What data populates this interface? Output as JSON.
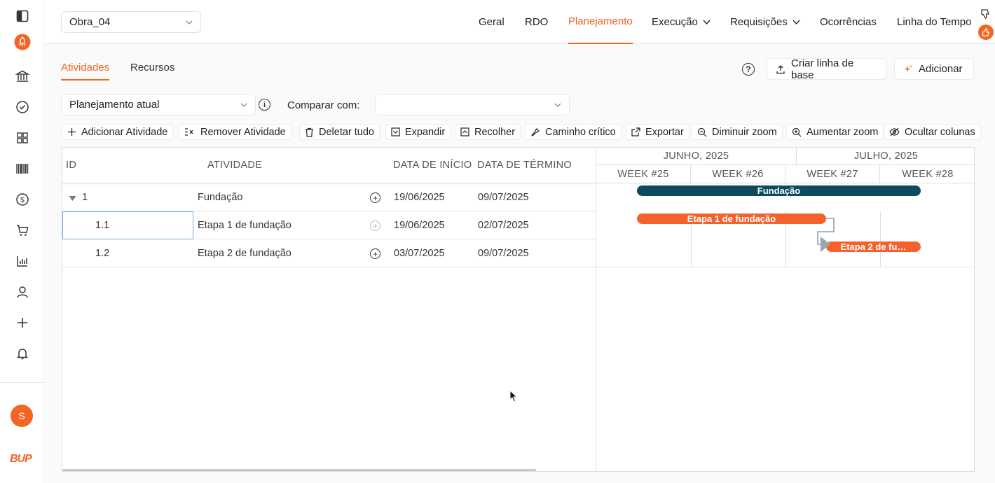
{
  "project_select": {
    "value": "Obra_04"
  },
  "nav": [
    {
      "label": "Geral"
    },
    {
      "label": "RDO"
    },
    {
      "label": "Planejamento"
    },
    {
      "label": "Execução"
    },
    {
      "label": "Requisições"
    },
    {
      "label": "Ocorrências"
    },
    {
      "label": "Linha do Tempo"
    }
  ],
  "subtabs": {
    "activities": "Atividades",
    "resources": "Recursos"
  },
  "actions": {
    "baseline": "Criar linha de base",
    "add": "Adicionar"
  },
  "plan_select": {
    "value": "Planejamento atual"
  },
  "compare": {
    "label": "Comparar com:",
    "value": ""
  },
  "toolbar": {
    "add_activity": "Adicionar Atividade",
    "remove_activity": "Remover Atividade",
    "delete_all": "Deletar tudo",
    "expand": "Expandir",
    "collapse": "Recolher",
    "critical_path": "Caminho crítico",
    "export": "Exportar",
    "zoom_out": "Diminuir zoom",
    "zoom_in": "Aumentar zoom",
    "hide_columns": "Ocultar colunas"
  },
  "grid": {
    "headers": {
      "id": "ID",
      "activity": "ATIVIDADE",
      "start": "DATA DE INÍCIO",
      "end": "DATA DE TÉRMINO"
    },
    "rows": [
      {
        "id": "1",
        "activity": "Fundação",
        "start": "19/06/2025",
        "end": "09/07/2025"
      },
      {
        "id": "1.1",
        "activity": "Etapa 1 de fundação",
        "start": "19/06/2025",
        "end": "02/07/2025"
      },
      {
        "id": "1.2",
        "activity": "Etapa 2 de fundação",
        "start": "03/07/2025",
        "end": "09/07/2025"
      }
    ]
  },
  "gantt": {
    "months": [
      "JUNHO, 2025",
      "JULHO, 2025"
    ],
    "weeks": [
      "WEEK #25",
      "WEEK #26",
      "WEEK #27",
      "WEEK #28"
    ],
    "bars": [
      "Fundação",
      "Etapa 1 de fundação",
      "Etapa 2 de fu…"
    ]
  },
  "user": {
    "initial": "S"
  },
  "brand": {
    "text": "BUP"
  },
  "colors": {
    "accent": "#f26522",
    "summary_bar": "#0e4a5e",
    "task_bar": "#f5612d",
    "selection": "#7aa7d8"
  }
}
